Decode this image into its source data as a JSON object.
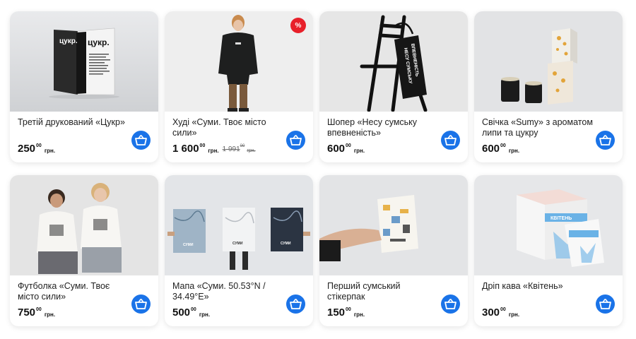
{
  "products": [
    {
      "title": "Третій друкований «Цукр»",
      "price": "250",
      "cents": "00",
      "currency": "грн."
    },
    {
      "title": "Худі «Суми. Твоє місто сили»",
      "price": "1 600",
      "cents": "00",
      "currency": "грн.",
      "old_price": "1 991",
      "old_cents": "00",
      "old_currency": "грн.",
      "badge": "%"
    },
    {
      "title": "Шопер «Несу сумську впевненість»",
      "price": "600",
      "cents": "00",
      "currency": "грн."
    },
    {
      "title": "Свічка «Sumy» з ароматом липи та цукру",
      "price": "600",
      "cents": "00",
      "currency": "грн."
    },
    {
      "title": "Футболка «Суми. Твоє місто сили»",
      "price": "750",
      "cents": "00",
      "currency": "грн."
    },
    {
      "title": "Мапа «Суми. 50.53°N / 34.49°E»",
      "price": "500",
      "cents": "00",
      "currency": "грн."
    },
    {
      "title": "Перший сумський стікерпак",
      "price": "150",
      "cents": "00",
      "currency": "грн."
    },
    {
      "title": "Дріп кава «Квітень»",
      "price": "300",
      "cents": "00",
      "currency": "грн."
    }
  ],
  "image_text": {
    "book_cover": "цукр.",
    "map_label": "СУМИ",
    "coffee_brand": "КВІТЕНЬ"
  },
  "colors": {
    "cart_button": "#1a73e8",
    "sale_badge": "#e8202a"
  },
  "icons": {
    "cart": "basket-icon"
  }
}
